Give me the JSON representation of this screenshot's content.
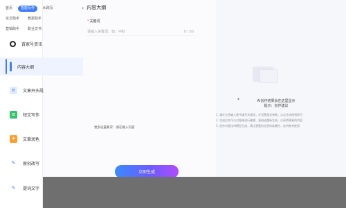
{
  "top_tabs": {
    "row1": [
      "首页",
      "智能写作",
      "AI改写"
    ],
    "row2": [
      "论文助手",
      "教案助手"
    ],
    "row3": [
      "营销助手",
      "职业文书"
    ]
  },
  "sidebar": {
    "items": [
      {
        "label": "百家号资讯",
        "icon": "circle-icon",
        "color": "#222222"
      },
      {
        "label": "内容大纲",
        "icon": "outline-icon",
        "color": "#3f7bff",
        "active": true
      },
      {
        "label": "文章开头段",
        "icon": "doc-icon",
        "color": "#3f7bff"
      },
      {
        "label": "短文写作",
        "icon": "pen-icon",
        "color": "#34c46a"
      },
      {
        "label": "文章润色",
        "icon": "polish-icon",
        "color": "#ff9f2b"
      },
      {
        "label": "原创改写",
        "icon": "edit-icon",
        "color": "#3f7bff"
      },
      {
        "label": "提词文字",
        "icon": "text-icon",
        "color": "#3f7bff"
      }
    ]
  },
  "panel": {
    "title": "内容大纲",
    "keyword_label": "关键词",
    "keyword_placeholder": "请输入关键词，如：中秋",
    "keyword_count": "0 / 50",
    "extra_note": "更多设置要求：请在输入内容",
    "generate_label": "立即生成"
  },
  "result": {
    "empty_title": "AI创作结果会在这里显示\n提示：创作建议",
    "tips": [
      "1. 请在左侧输入框中填写关键词，并设置相关参数，点击生成按钮即可",
      "2. 生成后你可以对结果进行编辑、复制或重新生成，以获得满意的内容",
      "3. 创作内容由AI模型生成，请注意甄别信息的准确性，仅供参考使用"
    ]
  },
  "colors": {
    "accent": "#3f7bff",
    "button_gradient_start": "#3a8bff",
    "button_gradient_end": "#b04bff"
  }
}
